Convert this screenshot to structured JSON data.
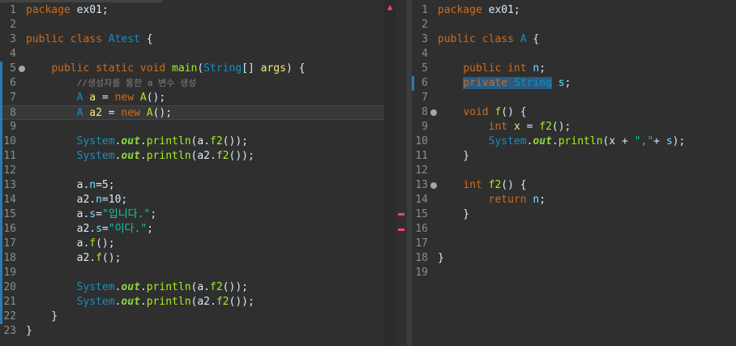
{
  "left_editor": {
    "lines": [
      {
        "n": "1",
        "parts": [
          {
            "t": "package",
            "c": "kw"
          },
          {
            "t": " ex01;"
          }
        ]
      },
      {
        "n": "2",
        "parts": []
      },
      {
        "n": "3",
        "parts": [
          {
            "t": "public class",
            "c": "kw"
          },
          {
            "t": " "
          },
          {
            "t": "Atest",
            "c": "ty"
          },
          {
            "t": " {"
          }
        ]
      },
      {
        "n": "4",
        "parts": []
      },
      {
        "n": "5",
        "fold": true,
        "parts": [
          {
            "t": "    "
          },
          {
            "t": "public static void",
            "c": "kw"
          },
          {
            "t": " "
          },
          {
            "t": "main",
            "c": "fn"
          },
          {
            "t": "("
          },
          {
            "t": "String",
            "c": "ty"
          },
          {
            "t": "[] "
          },
          {
            "t": "args",
            "c": "vr"
          },
          {
            "t": ") {"
          }
        ]
      },
      {
        "n": "6",
        "parts": [
          {
            "t": "        "
          },
          {
            "t": "//생성자를 통한 a 변수 생성",
            "c": "cm"
          }
        ]
      },
      {
        "n": "7",
        "parts": [
          {
            "t": "        "
          },
          {
            "t": "A",
            "c": "ty"
          },
          {
            "t": " "
          },
          {
            "t": "a",
            "c": "vr"
          },
          {
            "t": " = "
          },
          {
            "t": "new",
            "c": "kw"
          },
          {
            "t": " "
          },
          {
            "t": "A",
            "c": "fn"
          },
          {
            "t": "();"
          }
        ]
      },
      {
        "n": "8",
        "current": true,
        "parts": [
          {
            "t": "        "
          },
          {
            "t": "A",
            "c": "ty"
          },
          {
            "t": " "
          },
          {
            "t": "a2",
            "c": "vr"
          },
          {
            "t": " = "
          },
          {
            "t": "new",
            "c": "kw"
          },
          {
            "t": " "
          },
          {
            "t": "A",
            "c": "fn"
          },
          {
            "t": "();"
          }
        ]
      },
      {
        "n": "9",
        "parts": []
      },
      {
        "n": "10",
        "parts": [
          {
            "t": "        "
          },
          {
            "t": "System",
            "c": "ty"
          },
          {
            "t": "."
          },
          {
            "t": "out",
            "c": "sf"
          },
          {
            "t": "."
          },
          {
            "t": "println",
            "c": "fn"
          },
          {
            "t": "(a."
          },
          {
            "t": "f2",
            "c": "fn"
          },
          {
            "t": "());"
          }
        ]
      },
      {
        "n": "11",
        "parts": [
          {
            "t": "        "
          },
          {
            "t": "System",
            "c": "ty"
          },
          {
            "t": "."
          },
          {
            "t": "out",
            "c": "sf"
          },
          {
            "t": "."
          },
          {
            "t": "println",
            "c": "fn"
          },
          {
            "t": "(a2."
          },
          {
            "t": "f2",
            "c": "fn"
          },
          {
            "t": "());"
          }
        ]
      },
      {
        "n": "12",
        "parts": []
      },
      {
        "n": "13",
        "parts": [
          {
            "t": "        a."
          },
          {
            "t": "n",
            "c": "fd"
          },
          {
            "t": "=5;"
          }
        ]
      },
      {
        "n": "14",
        "parts": [
          {
            "t": "        a2."
          },
          {
            "t": "n",
            "c": "fd"
          },
          {
            "t": "=10;"
          }
        ]
      },
      {
        "n": "15",
        "error": true,
        "parts": [
          {
            "t": "        a."
          },
          {
            "t": "s",
            "c": "fd"
          },
          {
            "t": "="
          },
          {
            "t": "\"입니다.\"",
            "c": "st"
          },
          {
            "t": ";"
          }
        ]
      },
      {
        "n": "16",
        "error": true,
        "parts": [
          {
            "t": "        a2."
          },
          {
            "t": "s",
            "c": "fd"
          },
          {
            "t": "="
          },
          {
            "t": "\"이다.\"",
            "c": "st"
          },
          {
            "t": ";"
          }
        ]
      },
      {
        "n": "17",
        "parts": [
          {
            "t": "        a."
          },
          {
            "t": "f",
            "c": "fn"
          },
          {
            "t": "();"
          }
        ]
      },
      {
        "n": "18",
        "parts": [
          {
            "t": "        a2."
          },
          {
            "t": "f",
            "c": "fn"
          },
          {
            "t": "();"
          }
        ]
      },
      {
        "n": "19",
        "parts": []
      },
      {
        "n": "20",
        "parts": [
          {
            "t": "        "
          },
          {
            "t": "System",
            "c": "ty"
          },
          {
            "t": "."
          },
          {
            "t": "out",
            "c": "sf"
          },
          {
            "t": "."
          },
          {
            "t": "println",
            "c": "fn"
          },
          {
            "t": "(a."
          },
          {
            "t": "f2",
            "c": "fn"
          },
          {
            "t": "());"
          }
        ]
      },
      {
        "n": "21",
        "parts": [
          {
            "t": "        "
          },
          {
            "t": "System",
            "c": "ty"
          },
          {
            "t": "."
          },
          {
            "t": "out",
            "c": "sf"
          },
          {
            "t": "."
          },
          {
            "t": "println",
            "c": "fn"
          },
          {
            "t": "(a2."
          },
          {
            "t": "f2",
            "c": "fn"
          },
          {
            "t": "());"
          }
        ]
      },
      {
        "n": "22",
        "parts": [
          {
            "t": "    }"
          }
        ]
      },
      {
        "n": "23",
        "parts": [
          {
            "t": "}"
          }
        ]
      }
    ]
  },
  "right_editor": {
    "lines": [
      {
        "n": "1",
        "parts": [
          {
            "t": "package",
            "c": "kw"
          },
          {
            "t": " ex01;"
          }
        ]
      },
      {
        "n": "2",
        "parts": []
      },
      {
        "n": "3",
        "parts": [
          {
            "t": "public class",
            "c": "kw"
          },
          {
            "t": " "
          },
          {
            "t": "A",
            "c": "ty"
          },
          {
            "t": " {"
          }
        ]
      },
      {
        "n": "4",
        "parts": []
      },
      {
        "n": "5",
        "parts": [
          {
            "t": "    "
          },
          {
            "t": "public int",
            "c": "kw"
          },
          {
            "t": " "
          },
          {
            "t": "n",
            "c": "fd"
          },
          {
            "t": ";"
          }
        ]
      },
      {
        "n": "6",
        "parts": [
          {
            "t": "    "
          },
          {
            "t": "private",
            "c": "kw",
            "sel": true
          },
          {
            "t": " ",
            "sel": true
          },
          {
            "t": "String",
            "c": "ty",
            "sel": true
          },
          {
            "t": " "
          },
          {
            "t": "s",
            "c": "fd"
          },
          {
            "t": ";"
          }
        ]
      },
      {
        "n": "7",
        "parts": []
      },
      {
        "n": "8",
        "fold": true,
        "parts": [
          {
            "t": "    "
          },
          {
            "t": "void",
            "c": "kw"
          },
          {
            "t": " "
          },
          {
            "t": "f",
            "c": "fn"
          },
          {
            "t": "() {"
          }
        ]
      },
      {
        "n": "9",
        "parts": [
          {
            "t": "        "
          },
          {
            "t": "int",
            "c": "kw"
          },
          {
            "t": " "
          },
          {
            "t": "x",
            "c": "vr"
          },
          {
            "t": " = "
          },
          {
            "t": "f2",
            "c": "fn"
          },
          {
            "t": "();"
          }
        ]
      },
      {
        "n": "10",
        "parts": [
          {
            "t": "        "
          },
          {
            "t": "System",
            "c": "ty"
          },
          {
            "t": "."
          },
          {
            "t": "out",
            "c": "sf"
          },
          {
            "t": "."
          },
          {
            "t": "println",
            "c": "fn"
          },
          {
            "t": "(x + "
          },
          {
            "t": "\",\"",
            "c": "st"
          },
          {
            "t": "+ "
          },
          {
            "t": "s",
            "c": "fd"
          },
          {
            "t": ");"
          }
        ]
      },
      {
        "n": "11",
        "parts": [
          {
            "t": "    }"
          }
        ]
      },
      {
        "n": "12",
        "parts": []
      },
      {
        "n": "13",
        "fold": true,
        "parts": [
          {
            "t": "    "
          },
          {
            "t": "int",
            "c": "kw"
          },
          {
            "t": " "
          },
          {
            "t": "f2",
            "c": "fn"
          },
          {
            "t": "() {"
          }
        ]
      },
      {
        "n": "14",
        "parts": [
          {
            "t": "        "
          },
          {
            "t": "return",
            "c": "kw"
          },
          {
            "t": " "
          },
          {
            "t": "n",
            "c": "fd"
          },
          {
            "t": ";"
          }
        ]
      },
      {
        "n": "15",
        "parts": [
          {
            "t": "    }"
          }
        ]
      },
      {
        "n": "16",
        "parts": []
      },
      {
        "n": "17",
        "parts": []
      },
      {
        "n": "18",
        "parts": [
          {
            "t": "}"
          }
        ]
      },
      {
        "n": "19",
        "parts": []
      }
    ]
  }
}
